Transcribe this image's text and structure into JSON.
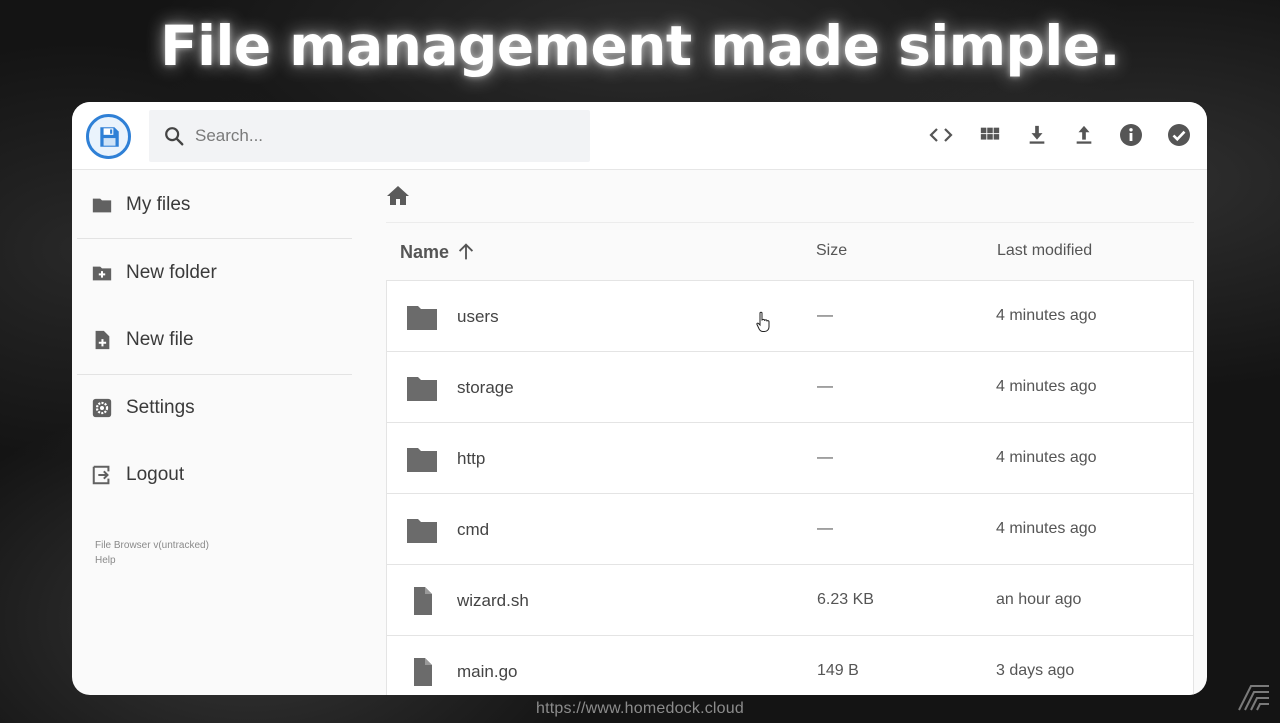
{
  "headline": "File management made simple.",
  "search": {
    "placeholder": "Search..."
  },
  "toolbar": {
    "icons": [
      "code-icon",
      "grid-view-icon",
      "download-icon",
      "upload-icon",
      "info-icon",
      "check-circle-icon"
    ]
  },
  "sidebar": {
    "items": [
      {
        "label": "My files",
        "icon": "folder-icon"
      },
      {
        "label": "New folder",
        "icon": "new-folder-icon"
      },
      {
        "label": "New file",
        "icon": "new-file-icon"
      },
      {
        "label": "Settings",
        "icon": "settings-icon"
      },
      {
        "label": "Logout",
        "icon": "logout-icon"
      }
    ],
    "footer": {
      "version": "File Browser v(untracked)",
      "help": "Help"
    }
  },
  "breadcrumb": {
    "icon": "home-icon"
  },
  "columns": {
    "name": "Name",
    "size": "Size",
    "modified": "Last modified"
  },
  "files": [
    {
      "name": "users",
      "type": "folder",
      "size": "—",
      "modified": "4 minutes ago"
    },
    {
      "name": "storage",
      "type": "folder",
      "size": "—",
      "modified": "4 minutes ago"
    },
    {
      "name": "http",
      "type": "folder",
      "size": "—",
      "modified": "4 minutes ago"
    },
    {
      "name": "cmd",
      "type": "folder",
      "size": "—",
      "modified": "4 minutes ago"
    },
    {
      "name": "wizard.sh",
      "type": "file",
      "size": "6.23 KB",
      "modified": "an hour ago"
    },
    {
      "name": "main.go",
      "type": "file",
      "size": "149 B",
      "modified": "3 days ago"
    }
  ],
  "watermark": "https://www.homedock.cloud",
  "colors": {
    "accent": "#2f80d6",
    "icon": "#616161",
    "text": "#3a3a3a"
  }
}
